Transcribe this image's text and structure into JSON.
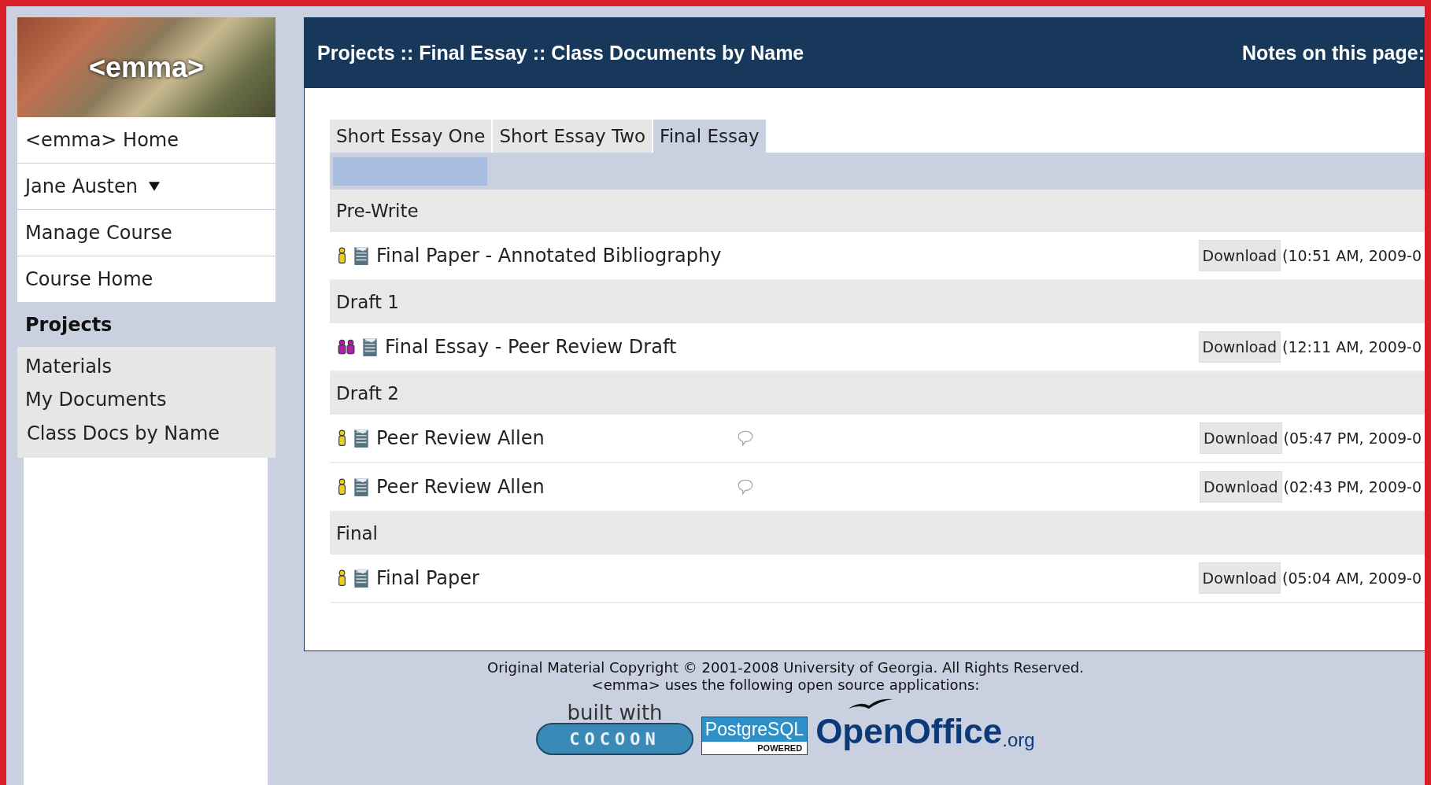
{
  "sidebar": {
    "logo": "<emma>",
    "items": [
      {
        "label": "<emma> Home",
        "dropdown": false
      },
      {
        "label": "Jane Austen",
        "dropdown": true
      },
      {
        "label": "Manage Course",
        "dropdown": false
      },
      {
        "label": "Course Home",
        "dropdown": false
      }
    ],
    "section": "Projects",
    "subitems": [
      {
        "label": "Materials"
      },
      {
        "label": "My Documents"
      },
      {
        "label": "Class Docs by Name"
      }
    ]
  },
  "header": {
    "title": "Projects :: Final Essay :: Class Documents by Name",
    "notes": "Notes on this page:"
  },
  "tabs": [
    {
      "label": "Short Essay One",
      "selected": false
    },
    {
      "label": "Short Essay Two",
      "selected": false
    },
    {
      "label": "Final Essay",
      "selected": true
    }
  ],
  "sections": [
    {
      "name": "Pre-Write",
      "rows": [
        {
          "kind": "individual",
          "title": "Final Paper - Annotated Bibliography",
          "comment": false,
          "button": "Download",
          "time": "(10:51 AM, 2009-0"
        }
      ]
    },
    {
      "name": "Draft 1",
      "rows": [
        {
          "kind": "group",
          "title": "Final Essay - Peer Review Draft",
          "comment": false,
          "button": "Download",
          "time": "(12:11 AM, 2009-0"
        }
      ]
    },
    {
      "name": "Draft 2",
      "rows": [
        {
          "kind": "individual",
          "title": "Peer Review Allen",
          "comment": true,
          "button": "Download",
          "time": "(05:47 PM, 2009-0"
        },
        {
          "kind": "individual",
          "title": "Peer Review Allen",
          "comment": true,
          "button": "Download",
          "time": "(02:43 PM, 2009-0"
        }
      ]
    },
    {
      "name": "Final",
      "rows": [
        {
          "kind": "individual",
          "title": "Final Paper",
          "comment": false,
          "button": "Download",
          "time": "(05:04 AM, 2009-0"
        }
      ]
    }
  ],
  "footer": {
    "copyright": "Original Material Copyright © 2001-2008 University of Georgia. All Rights Reserved.",
    "apps": "<emma> uses the following open source applications:",
    "cocoon_caption": "built with",
    "cocoon": "COCOON",
    "postgres": "PostgreSQL",
    "postgres_sub": "POWERED",
    "openoffice": "OpenOffice",
    "openoffice_suffix": ".org"
  }
}
